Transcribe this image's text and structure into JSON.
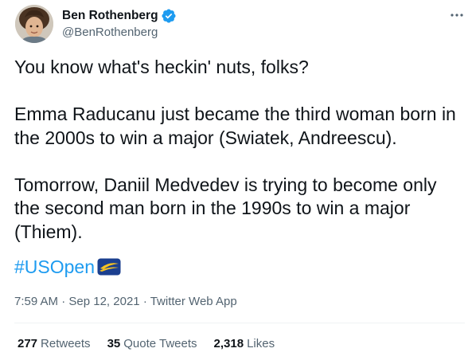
{
  "author": {
    "display_name": "Ben Rothenberg",
    "handle": "@BenRothenberg",
    "verified": true
  },
  "tweet": {
    "paragraphs": [
      "You know what's heckin' nuts, folks?",
      "Emma Raducanu just became the third woman born in the 2000s to win a major (Swiatek, Andreescu).",
      "Tomorrow, Daniil Medvedev is trying to become only the second man born in the 1990s to win a major (Thiem)."
    ],
    "hashtag": "#USOpen",
    "time": "7:59 AM",
    "date": "Sep 12, 2021",
    "source": "Twitter Web App",
    "separator": "·"
  },
  "stats": {
    "retweets_count": "277",
    "retweets_label": "Retweets",
    "quotes_count": "35",
    "quotes_label": "Quote Tweets",
    "likes_count": "2,318",
    "likes_label": "Likes"
  },
  "icons": {
    "verified": "verified-badge-icon",
    "more": "more-options-icon",
    "hashflag": "usopen-hashflag-icon"
  },
  "colors": {
    "link": "#1d9bf0",
    "secondary_text": "#536471",
    "primary_text": "#0f1419"
  }
}
